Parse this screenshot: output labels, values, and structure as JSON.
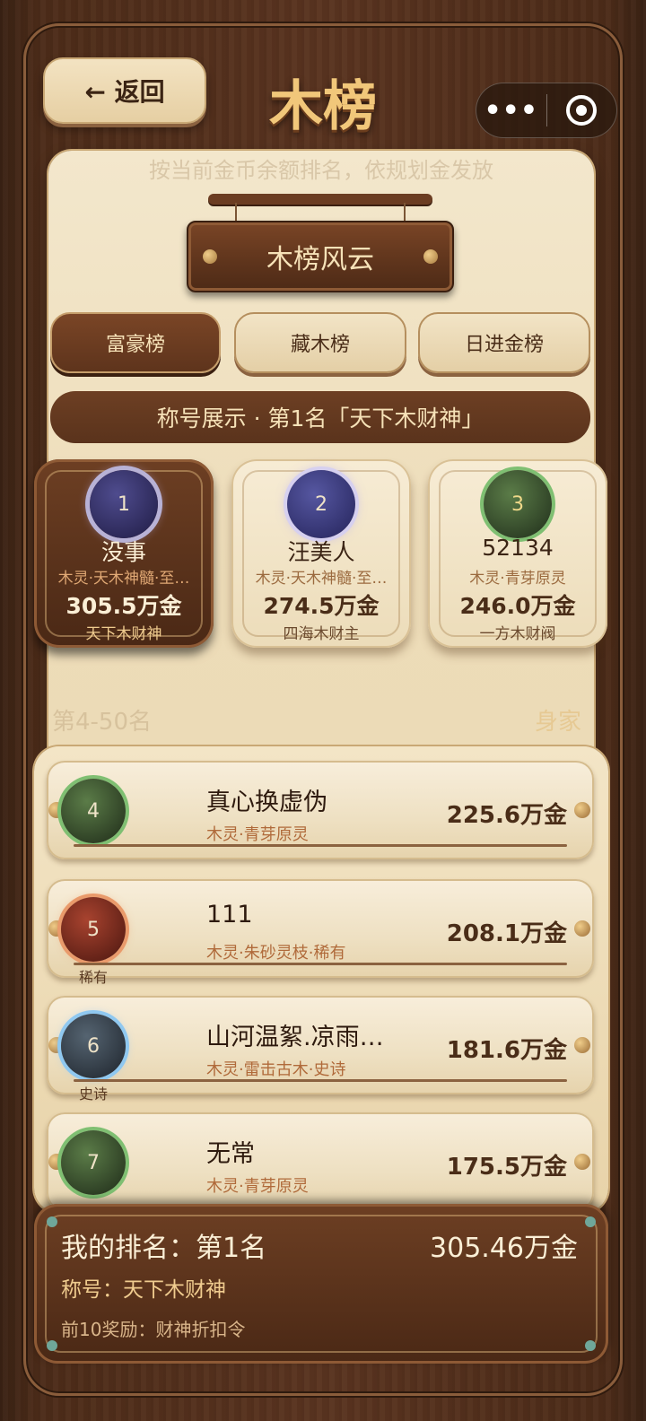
{
  "header": {
    "back_label": "← 返回",
    "title": "木榜",
    "capsule_more": "•••"
  },
  "notice": "按当前金币余额排名，依规划金发放",
  "board_title": "木榜风云",
  "tabs": [
    {
      "label": "富豪榜",
      "active": true
    },
    {
      "label": "藏木榜",
      "active": false
    },
    {
      "label": "日进金榜",
      "active": false
    }
  ],
  "title_strip": "称号展示 · 第1名「天下木财神」",
  "podium": [
    {
      "rank": "1",
      "name": "没事",
      "sub": "木灵·天木神髓·至…",
      "amount": "305.5万金",
      "tag": "天下木财神"
    },
    {
      "rank": "2",
      "name": "汪美人",
      "sub": "木灵·天木神髓·至…",
      "amount": "274.5万金",
      "tag": "四海木财主"
    },
    {
      "rank": "3",
      "name": "52134",
      "sub": "木灵·青芽原灵",
      "amount": "246.0万金",
      "tag": "一方木财阀"
    }
  ],
  "section": {
    "left_label": "第4-50名",
    "right_label": "身家"
  },
  "list": [
    {
      "rank": "4",
      "name": "真心换虚伪",
      "sub": "木灵·青芽原灵",
      "amount": "225.6万金",
      "rarity": ""
    },
    {
      "rank": "5",
      "name": "111",
      "sub": "木灵·朱砂灵枝·稀有",
      "amount": "208.1万金",
      "rarity": "稀有"
    },
    {
      "rank": "6",
      "name": "山河温絮.凉雨…",
      "sub": "木灵·雷击古木·史诗",
      "amount": "181.6万金",
      "rarity": "史诗"
    },
    {
      "rank": "7",
      "name": "无常",
      "sub": "木灵·青芽原灵",
      "amount": "175.5万金",
      "rarity": ""
    }
  ],
  "mine": {
    "rank_text": "我的排名：第1名",
    "amount": "305.46万金",
    "title_text": "称号：天下木财神",
    "reward_text": "前10奖励：财神折扣令"
  }
}
